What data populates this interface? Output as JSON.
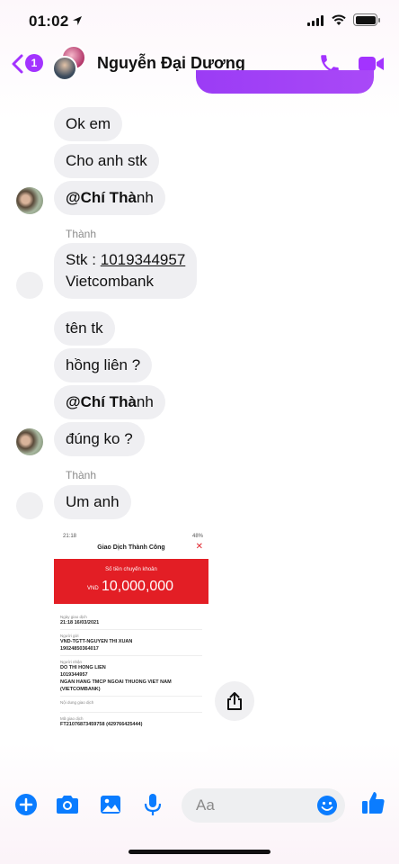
{
  "status_bar": {
    "time": "01:02"
  },
  "header": {
    "unread_count": "1",
    "contact_name": "Nguyễn Đại Dương"
  },
  "messages": {
    "m1": "Ok em",
    "m2": "Cho anh stk",
    "m3_mention": "@Chí Thà",
    "m3_rest": "nh",
    "sender1": "Thành",
    "m4_prefix": "Stk : ",
    "m4_number": "1019344957",
    "m4_line2": "Vietcombank",
    "m5": "tên tk",
    "m6": "hồng liên ?",
    "m7_mention": "@Chí Thà",
    "m7_rest": "nh",
    "m8": "đúng ko ?",
    "sender2": "Thành",
    "m9": "Um anh"
  },
  "receipt": {
    "status_time": "21:18",
    "status_battery": "48%",
    "title": "Giao Dịch Thành Công",
    "amount_label": "Số tiền chuyển khoản",
    "currency": "VND",
    "amount": "10,000,000",
    "date_label": "Ngày giao dịch",
    "date_value": "21:18 16/03/2021",
    "sender_label": "Người gửi",
    "sender_name": "VND-TGTT-NGUYEN THI XUAN",
    "sender_account": "19024850364017",
    "receiver_label": "Người nhận",
    "receiver_name": "DO THI HONG LIEN",
    "receiver_account": "1019344957",
    "receiver_bank": "NGAN HANG TMCP NGOAI THUONG VIET NAM",
    "receiver_bank_short": "(VIETCOMBANK)",
    "content_label": "Nội dung giao dịch",
    "txn_label": "Mã giao dịch",
    "txn_value": "FT21076873459758 (429766425444)"
  },
  "composer": {
    "placeholder": "Aa"
  },
  "colors": {
    "accent": "#a333ff",
    "bubble": "#efeff2",
    "receipt_red": "#e31e25",
    "messenger_blue": "#0a7cff"
  }
}
